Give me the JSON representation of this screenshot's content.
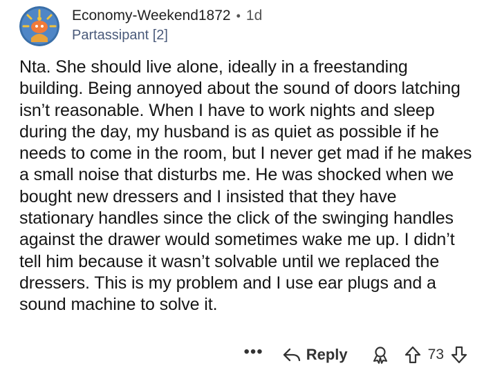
{
  "comment": {
    "username": "Economy-Weekend1872",
    "separator": "•",
    "age": "1d",
    "flair": "Partassipant [2]",
    "body": "Nta. She should live alone, ideally in a freestanding building. Being annoyed about the sound of doors latching isn’t reasonable. When I have to work nights and sleep during the day, my husband is as quiet as possible if he needs to come in the room, but I never get mad if he makes a small noise that disturbs me. He was shocked when we bought new dressers and I insisted that they have stationary handles since the click of the swinging handles against the drawer would sometimes wake me up. I didn’t tell him because it wasn’t solvable until we replaced the dressers. This is my problem and I use ear plugs and a sound machine to solve it."
  },
  "actions": {
    "more_label": "•••",
    "reply_label": "Reply",
    "vote_count": "73"
  },
  "icons": {
    "avatar": "snoo-avatar",
    "reply": "reply-arrow-icon",
    "award": "award-icon",
    "upvote": "upvote-arrow-icon",
    "downvote": "downvote-arrow-icon"
  }
}
